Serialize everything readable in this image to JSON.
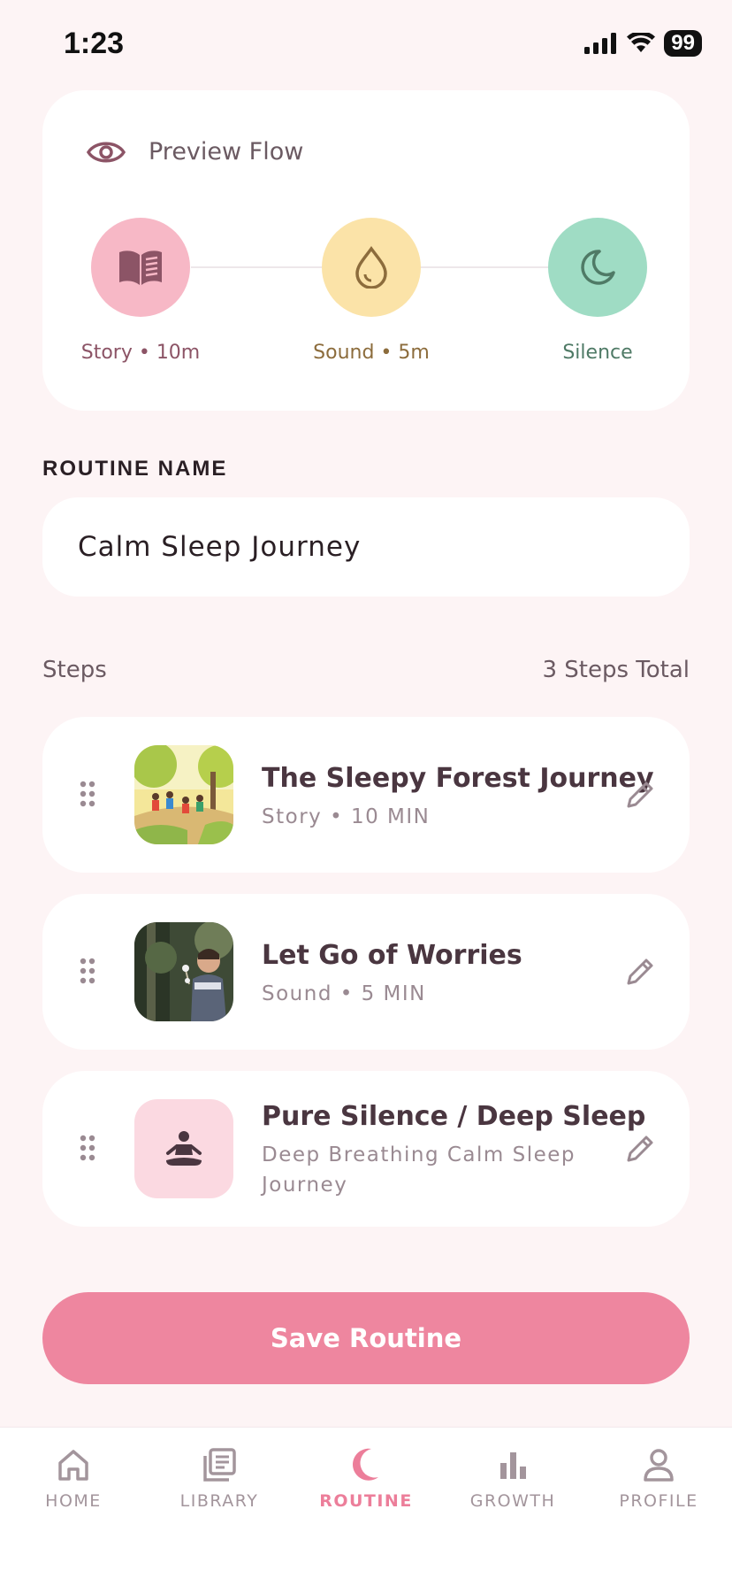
{
  "status": {
    "time": "1:23",
    "battery": "99"
  },
  "preview": {
    "title": "Preview Flow",
    "steps": [
      {
        "label": "Story • 10m",
        "color": "#f7b8c6",
        "icon": "book-icon",
        "text_color": "#8c5466"
      },
      {
        "label": "Sound • 5m",
        "color": "#fbe3a8",
        "icon": "water-drop-icon",
        "text_color": "#8c6c3c"
      },
      {
        "label": "Silence",
        "color": "#9fdcc4",
        "icon": "moon-icon",
        "text_color": "#4f7a66"
      }
    ]
  },
  "routine": {
    "name_label": "ROUTINE NAME",
    "name_value": "Calm Sleep Journey"
  },
  "steps_header": {
    "label": "Steps",
    "total": "3 Steps Total"
  },
  "steps": [
    {
      "title": "The Sleepy Forest Journey",
      "subtitle": "Story • 10 MIN",
      "thumb": "forest-illustration"
    },
    {
      "title": "Let Go of Worries",
      "subtitle": "Sound • 5 MIN",
      "thumb": "child-photo"
    },
    {
      "title": "Pure Silence / Deep Sleep",
      "subtitle": "Deep Breathing Calm Sleep Journey",
      "thumb": "meditation-icon"
    }
  ],
  "save_label": "Save Routine",
  "tabs": [
    {
      "label": "HOME",
      "icon": "home-icon",
      "active": false
    },
    {
      "label": "LIBRARY",
      "icon": "library-icon",
      "active": false
    },
    {
      "label": "ROUTINE",
      "icon": "moon-icon",
      "active": true
    },
    {
      "label": "GROWTH",
      "icon": "bar-chart-icon",
      "active": false
    },
    {
      "label": "PROFILE",
      "icon": "profile-icon",
      "active": false
    }
  ],
  "colors": {
    "accent": "#ee869f",
    "background": "#fdf4f5"
  }
}
